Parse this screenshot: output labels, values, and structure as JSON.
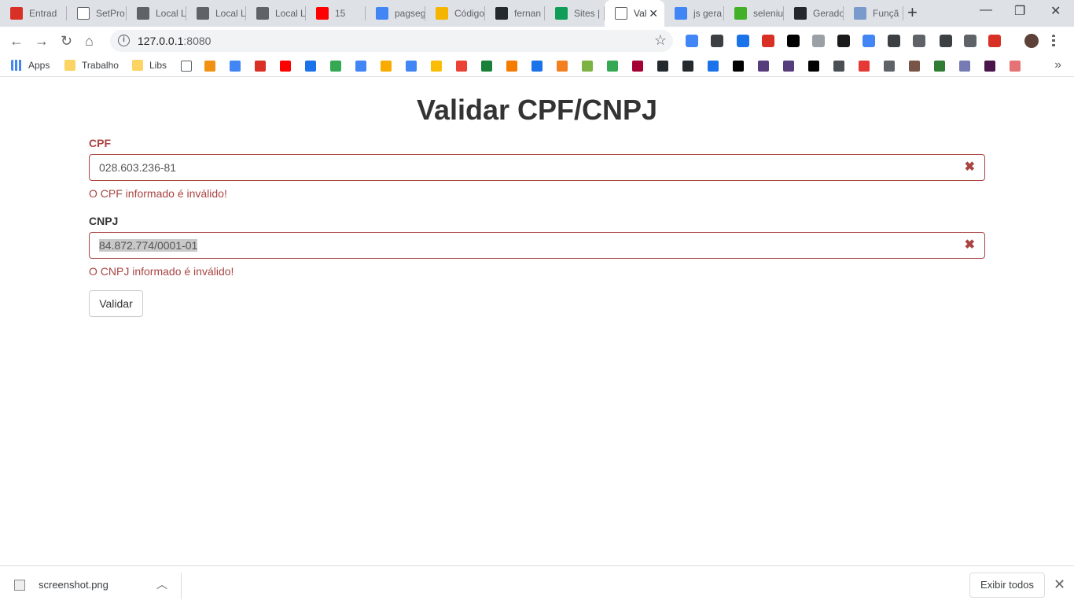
{
  "browser": {
    "tabs": [
      {
        "label": "Entrad",
        "icon": "gmail-icon",
        "color": "#d93025"
      },
      {
        "label": "SetPro",
        "icon": "page-icon",
        "color": "#ffffff"
      },
      {
        "label": "Local L",
        "icon": "local-icon",
        "color": "#5f6368"
      },
      {
        "label": "Local L",
        "icon": "local-icon",
        "color": "#5f6368"
      },
      {
        "label": "Local L",
        "icon": "local-icon",
        "color": "#5f6368"
      },
      {
        "label": "15",
        "icon": "youtube-icon",
        "color": "#ff0000"
      },
      {
        "label": "pagseg",
        "icon": "google-icon",
        "color": "#4285f4"
      },
      {
        "label": "Código",
        "icon": "code-icon",
        "color": "#f4b400"
      },
      {
        "label": "fernan",
        "icon": "github-icon",
        "color": "#24292e"
      },
      {
        "label": "Sites |",
        "icon": "sites-icon",
        "color": "#0f9d58"
      },
      {
        "label": "Val",
        "icon": "page-icon",
        "color": "#ffffff",
        "active": true
      },
      {
        "label": "js gera",
        "icon": "google-icon",
        "color": "#4285f4"
      },
      {
        "label": "seleniu",
        "icon": "selenium-icon",
        "color": "#43b02a"
      },
      {
        "label": "Gerado",
        "icon": "github-icon",
        "color": "#24292e"
      },
      {
        "label": "Funçã",
        "icon": "function-icon",
        "color": "#7b9acc"
      }
    ],
    "address": {
      "host": "127.0.0.1",
      "port": ":8080"
    },
    "bookmarks": [
      {
        "label": "Apps",
        "icon": "apps-icon"
      },
      {
        "label": "Trabalho",
        "icon": "folder-icon"
      },
      {
        "label": "Libs",
        "icon": "folder-icon"
      }
    ],
    "colors": {
      "tabstrip": "#dee1e6",
      "error": "#a94442"
    }
  },
  "page": {
    "title": "Validar CPF/CNPJ",
    "cpf": {
      "label": "CPF",
      "value": "028.603.236-81",
      "error": "O CPF informado é inválido!"
    },
    "cnpj": {
      "label": "CNPJ",
      "value": "84.872.774/0001-01",
      "error": "O CNPJ informado é inválido!"
    },
    "submit_label": "Validar"
  },
  "downloads": {
    "file": "screenshot.png",
    "show_all": "Exibir todos"
  }
}
